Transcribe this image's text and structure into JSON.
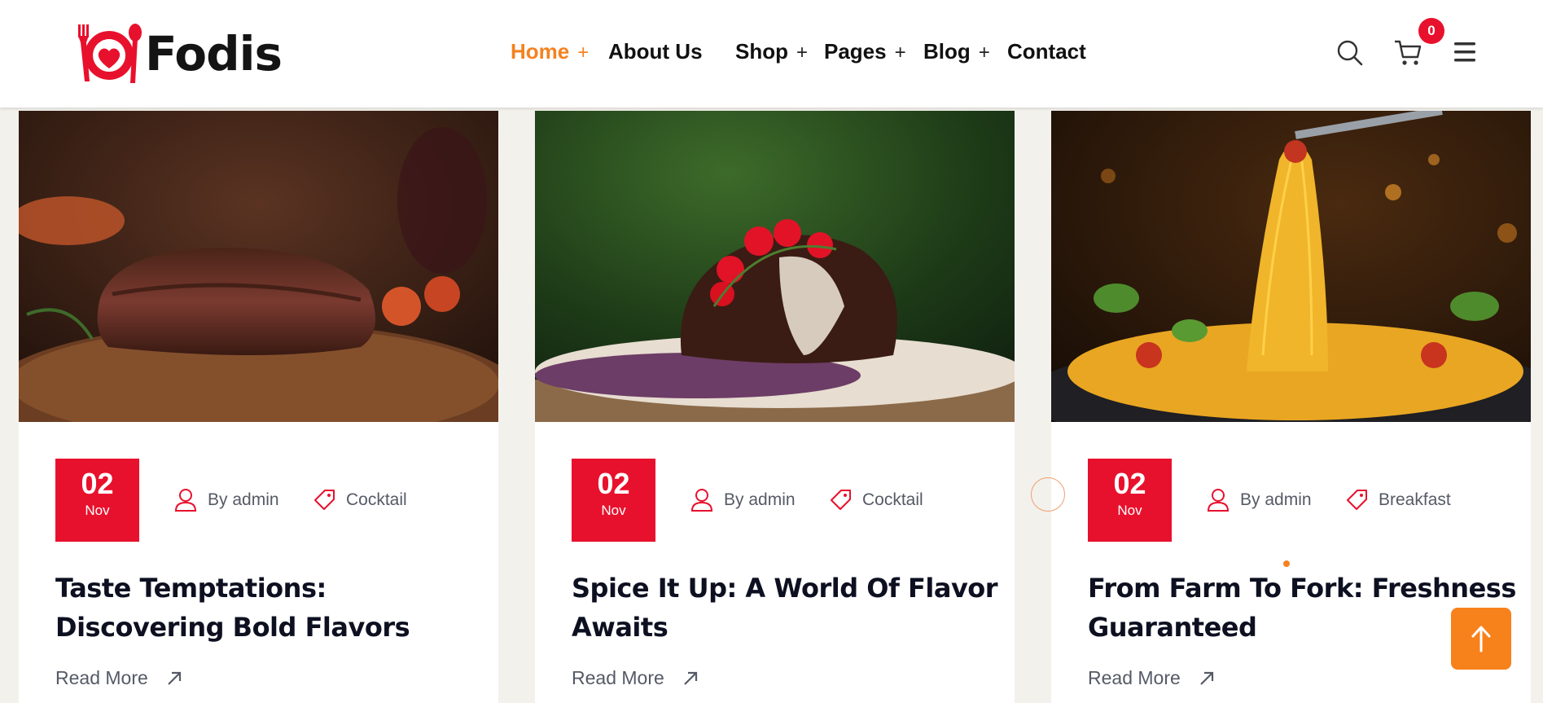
{
  "brand": {
    "name": "Fodis",
    "accent": "#e8112d",
    "highlight": "#f58220"
  },
  "nav": {
    "items": [
      {
        "label": "Home",
        "has_submenu": true,
        "active": true
      },
      {
        "label": "About Us",
        "has_submenu": false,
        "active": false
      },
      {
        "label": "Shop",
        "has_submenu": true,
        "active": false
      },
      {
        "label": "Pages",
        "has_submenu": true,
        "active": false
      },
      {
        "label": "Blog",
        "has_submenu": true,
        "active": false
      },
      {
        "label": "Contact",
        "has_submenu": false,
        "active": false
      }
    ],
    "submenu_marker": "+"
  },
  "header_actions": {
    "search_icon": "search-icon",
    "cart_icon": "cart-icon",
    "cart_count": "0",
    "menu_icon": "hamburger-menu-icon"
  },
  "posts": [
    {
      "day": "02",
      "month": "Nov",
      "author": "By admin",
      "category": "Cocktail",
      "title": "Taste Temptations: Discovering Bold Flavors",
      "read_more": "Read More",
      "image": "grilled steak on wooden board"
    },
    {
      "day": "02",
      "month": "Nov",
      "author": "By admin",
      "category": "Cocktail",
      "title": "Spice It Up: A World Of Flavor Awaits",
      "read_more": "Read More",
      "image": "steak topped with cherry tomatoes"
    },
    {
      "day": "02",
      "month": "Nov",
      "author": "By admin",
      "category": "Breakfast",
      "title": "From Farm To Fork: Freshness Guaranteed",
      "read_more": "Read More",
      "image": "spaghetti twirled on fork"
    }
  ],
  "scroll_top_icon": "arrow-up-icon"
}
